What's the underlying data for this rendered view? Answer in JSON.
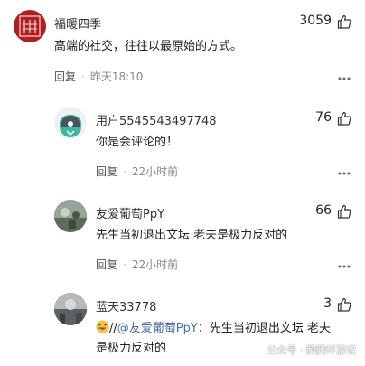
{
  "comments": [
    {
      "name": "福暖四季",
      "likes": "3059",
      "content": "高端的社交，往往以最原始的方式。",
      "reply_label": "回复",
      "time": "昨天18:10"
    },
    {
      "name": "用户5545543497748",
      "likes": "76",
      "content": "你是会评论的！",
      "reply_label": "回复",
      "time": "22小时前"
    },
    {
      "name": "友爱葡萄PpY",
      "likes": "66",
      "content": "先生当初退出文坛 老夫是极力反对的",
      "reply_label": "回复",
      "time": "22小时前"
    },
    {
      "name": "蓝天33778",
      "likes": "3",
      "content_prefix": "//",
      "content_mention": "@友爱葡萄PpY",
      "content_line1": "：先生当初退出文坛 老夫",
      "content_line2": "是极力反对的"
    }
  ],
  "watermark": "公众号 · 腾腾环游记",
  "colors": {
    "link": "#4a6fa5",
    "meta": "#888888"
  }
}
